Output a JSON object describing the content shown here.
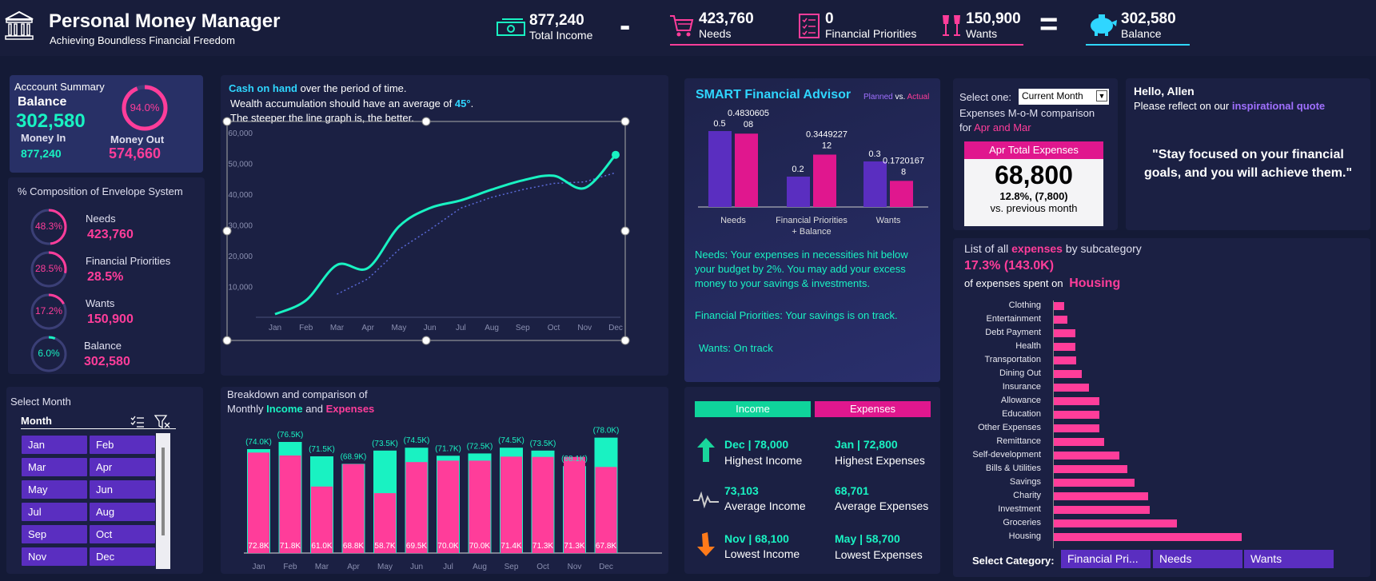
{
  "header": {
    "title": "Personal Money Manager",
    "subtitle": "Achieving Boundless Financial Freedom",
    "income": {
      "value": "877,240",
      "label": "Total Income"
    },
    "needs": {
      "value": "423,760",
      "label": "Needs"
    },
    "priorities": {
      "value": "0",
      "label": "Financial Priorities"
    },
    "wants": {
      "value": "150,900",
      "label": "Wants"
    },
    "balance": {
      "value": "302,580",
      "label": "Balance"
    },
    "minus": "-",
    "equals": "="
  },
  "account": {
    "title": "Acccount Summary",
    "balance_label": "Balance",
    "balance_value": "302,580",
    "pct": "94.0%",
    "pct_value": 0.94,
    "money_in_label": "Money In",
    "money_in": "877,240",
    "money_out_label": "Money Out",
    "money_out": "574,660"
  },
  "envelope": {
    "title": "% Composition of Envelope System",
    "items": [
      {
        "pct": "48.3%",
        "pct_value": 0.483,
        "name": "Needs",
        "value": "423,760",
        "color": "#ff3d9a"
      },
      {
        "pct": "28.5%",
        "pct_value": 0.285,
        "name": "Financial Priorities",
        "value": "28.5%",
        "color": "#ff3d9a"
      },
      {
        "pct": "17.2%",
        "pct_value": 0.172,
        "name": "Wants",
        "value": "150,900",
        "color": "#ff3d9a"
      },
      {
        "pct": "6.0%",
        "pct_value": 0.06,
        "name": "Balance",
        "value": "302,580",
        "color": "#19f2c2"
      }
    ]
  },
  "month_slicer": {
    "title": "Select Month",
    "header": "Month",
    "months": [
      "Jan",
      "Feb",
      "Mar",
      "Apr",
      "May",
      "Jun",
      "Jul",
      "Aug",
      "Sep",
      "Oct",
      "Nov",
      "Dec"
    ]
  },
  "cash": {
    "line1_bold": "Cash on hand",
    "line1_rest": " over the period of time.",
    "line2_pre": "Wealth accumulation should have an average of ",
    "line2_hl": "45°",
    "line2_post": ".",
    "line3": "The steeper the line graph is, the better."
  },
  "breakdown": {
    "line1": "Breakdown and comparison of",
    "line2_pre": "Monthly ",
    "income_word": "Income",
    "and_word": " and ",
    "expenses_word": "Expenses"
  },
  "advisor": {
    "title": "SMART Financial Advisor",
    "planned": "Planned",
    "vs": " vs. ",
    "actual": "Actual",
    "needs_msg": "Needs: Your expenses in necessities hit below your budget by 2%. You may add your excess money to your savings & investments.",
    "priorities_msg": "Financial Priorities: Your savings is on track.",
    "wants_msg": "Wants: On track"
  },
  "summary": {
    "income_tab": "Income",
    "expenses_tab": "Expenses",
    "highest_income": "Dec | 78,000",
    "highest_income_lbl": "Highest Income",
    "highest_exp": "Jan | 72,800",
    "highest_exp_lbl": "Highest Expenses",
    "avg_income": "73,103",
    "avg_income_lbl": "Average Income",
    "avg_exp": "68,701",
    "avg_exp_lbl": "Average Expenses",
    "lowest_income": "Nov | 68,100",
    "lowest_income_lbl": "Lowest Income",
    "lowest_exp": "May | 58,700",
    "lowest_exp_lbl": "Lowest Expenses"
  },
  "mom": {
    "select_label": "Select one:",
    "select_value": "Current Month",
    "line1": "Expenses M-o-M comparison",
    "line2_pre": "for ",
    "line2_hl": "Apr and Mar",
    "card_title": "Apr Total Expenses",
    "card_value": "68,800",
    "card_change": "12.8%, (7,800)",
    "card_note": "vs. previous month"
  },
  "greeting": {
    "hello": "Hello, Allen",
    "reflect_pre": "Please reflect on our ",
    "reflect_hl": "inspirational quote",
    "quote": "\"Stay focused on your financial goals, and you will achieve them.\""
  },
  "expenses_list": {
    "title_pre": "List of all ",
    "title_hl": "expenses",
    "title_post": " by subcategory",
    "stat": "17.3% (143.0K)",
    "spent_pre": "of expenses spent on",
    "spent_hl": "Housing",
    "select_label": "Select Category:",
    "categories": [
      "Financial Pri...",
      "Needs",
      "Wants"
    ]
  },
  "chart_data": [
    {
      "type": "line",
      "x": [
        "Jan",
        "Feb",
        "Mar",
        "Apr",
        "May",
        "Jun",
        "Jul",
        "Aug",
        "Sep",
        "Oct",
        "Nov",
        "Dec"
      ],
      "series": [
        {
          "values": [
            1000,
            5500,
            17000,
            16000,
            29500,
            35500,
            38000,
            41500,
            44500,
            46000,
            42000,
            52800
          ]
        },
        {
          "values": [
            null,
            null,
            7500,
            12500,
            22000,
            28500,
            35500,
            39000,
            41500,
            43500,
            44000,
            47000
          ]
        }
      ],
      "yticks": [
        "",
        "10,000",
        "20,000",
        "30,000",
        "40,000",
        "50,000",
        "60,000"
      ],
      "ylim": [
        0,
        60000
      ]
    },
    {
      "type": "bar",
      "categories": [
        "Jan",
        "Feb",
        "Mar",
        "Apr",
        "May",
        "Jun",
        "Jul",
        "Aug",
        "Sep",
        "Oct",
        "Nov",
        "Dec"
      ],
      "series": [
        {
          "name": "Income",
          "values": [
            74.0,
            76.5,
            71.5,
            68.9,
            73.5,
            74.5,
            71.7,
            72.5,
            74.5,
            73.5,
            68.1,
            78.0
          ]
        },
        {
          "name": "Expenses",
          "values": [
            72.8,
            71.8,
            61.0,
            68.8,
            58.7,
            69.5,
            70.0,
            70.0,
            71.4,
            71.3,
            71.3,
            67.8
          ]
        }
      ],
      "income_labels": [
        "(74.0K)",
        "(76.5K)",
        "(71.5K)",
        "(68.9K)",
        "(73.5K)",
        "(74.5K)",
        "(71.7K)",
        "(72.5K)",
        "(74.5K)",
        "(73.5K)",
        "(68.1K)",
        "(78.0K)"
      ],
      "expense_labels": [
        "72.8K",
        "71.8K",
        "61.0K",
        "68.8K",
        "58.7K",
        "69.5K",
        "70.0K",
        "70.0K",
        "71.4K",
        "71.3K",
        "71.3K",
        "67.8K"
      ],
      "ylim": [
        0,
        80
      ]
    },
    {
      "type": "bar",
      "categories": [
        "Needs",
        "Financial Priorities + Balance",
        "Wants"
      ],
      "series": [
        {
          "name": "Planned",
          "values": [
            0.5,
            0.2,
            0.3
          ]
        },
        {
          "name": "Actual",
          "values": [
            0.483060508,
            0.344922712,
            0.17201678
          ]
        }
      ],
      "planned_labels": [
        "0.5",
        "0.2",
        "0.3"
      ],
      "actual_labels": [
        "0.4830605\n08",
        "0.3449227\n12",
        "0.1720167\n8"
      ],
      "ylim": [
        0,
        0.6
      ]
    },
    {
      "type": "bar",
      "orientation": "horizontal",
      "categories": [
        "Clothing",
        "Entertainment",
        "Debt Payment",
        "Health",
        "Transportation",
        "Dining Out",
        "Insurance",
        "Allowance",
        "Education",
        "Other Expenses",
        "Remittance",
        "Self-development",
        "Bills & Utilities",
        "Savings",
        "Charity",
        "Investment",
        "Groceries",
        "Housing"
      ],
      "values": [
        14,
        18,
        28,
        28,
        29,
        36,
        45,
        58,
        58,
        58,
        64,
        83,
        93,
        102,
        119,
        121,
        155,
        236
      ],
      "ylim": [
        0,
        240
      ]
    }
  ]
}
